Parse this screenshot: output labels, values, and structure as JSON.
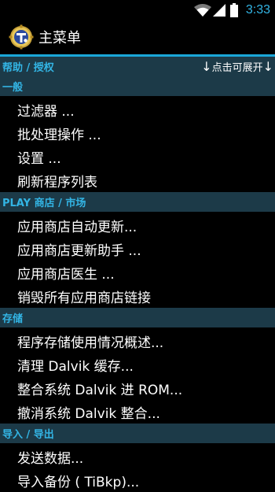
{
  "status_bar": {
    "time": "3:33",
    "icons": [
      "wifi-icon",
      "signal-icon",
      "battery-icon"
    ]
  },
  "action_bar": {
    "title": "主菜单",
    "app_icon": "titanium-backup-icon"
  },
  "sections": {
    "help": {
      "label": "帮助 / 授权",
      "expand_hint": "点击可展开",
      "left_arrow": "↓",
      "right_arrow": "↓"
    },
    "general": {
      "label": "一般",
      "items": {
        "filter": "过滤器 ...",
        "batch": "批处理操作 ...",
        "settings": "设置 ...",
        "refresh": "刷新程序列表"
      }
    },
    "play": {
      "label": "PLAY 商店 / 市场",
      "items": {
        "auto_update": "应用商店自动更新...",
        "update_helper": "应用商店更新助手 ...",
        "doctor": "应用商店医生 ...",
        "destroy_links": "销毁所有应用商店链接"
      }
    },
    "storage": {
      "label": "存储",
      "items": {
        "usage_overview": "程序存储使用情况概述...",
        "clean_dalvik": "清理 Dalvik 缓存...",
        "integrate_dalvik": "整合系统 Dalvik 进 ROM...",
        "undo_dalvik": "撤消系统 Dalvik 整合..."
      }
    },
    "import_export": {
      "label": "导入 / 导出",
      "items": {
        "send_data": "发送数据...",
        "import_backup": "导入备份 ( TiBkp)..."
      }
    }
  },
  "colors": {
    "accent": "#33b5e5",
    "divider": "#1aa7d9",
    "section_bg": "#1c3a48",
    "background": "#000000",
    "text": "#ffffff"
  }
}
